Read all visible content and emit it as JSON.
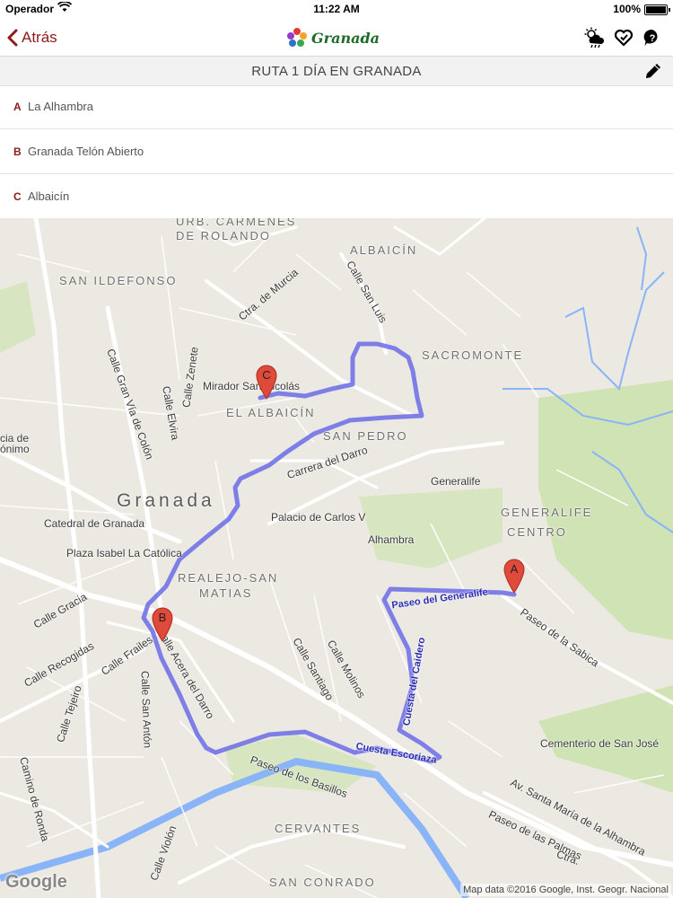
{
  "status": {
    "carrier": "Operador",
    "time": "11:22 AM",
    "battery": "100%"
  },
  "nav": {
    "back_label": "Atrás",
    "logo_text": "Granada"
  },
  "title": {
    "text": "RUTA 1 DÍA EN GRANADA"
  },
  "stops": [
    {
      "letter": "A",
      "name": "La Alhambra"
    },
    {
      "letter": "B",
      "name": "Granada Telón Abierto"
    },
    {
      "letter": "C",
      "name": "Albaicín"
    }
  ],
  "map": {
    "labels": {
      "urb_carmenes": "URB. CARMENES",
      "de_rolando": "DE ROLANDO",
      "albaicin_dist": "ALBAICÍN",
      "san_ildefonso": "SAN ILDEFONSO",
      "ctra_murcia": "Ctra. de Murcia",
      "calle_san_luis": "Calle San Luis",
      "sacromonte": "SACROMONTE",
      "mirador": "Mirador San Nicolás",
      "el_albaicin": "EL ALBAICÍN",
      "san_pedro": "SAN PEDRO",
      "carrera_darro": "Carrera del Darro",
      "generalife": "Generalife",
      "palacio": "Palacio de Carlos V",
      "generalife_centro_1": "GENERALIFE",
      "generalife_centro_2": "CENTRO",
      "alhambra": "Alhambra",
      "granada": "Granada",
      "catedral": "Catedral de Granada",
      "plaza_isabel": "Plaza Isabel La Católica",
      "realejo_1": "REALEJO-SAN",
      "realejo_2": "MATIAS",
      "calle_gran_via": "Calle Gran Vía de Colón",
      "calle_zenete": "Calle Zenete",
      "calle_elvira": "Calle Elvira",
      "calle_gracia": "Calle Gracia",
      "calle_recogidas": "Calle Recogidas",
      "calle_frailes": "Calle Frailes",
      "calle_tejeiro": "Calle Tejeiro",
      "calle_san_anton": "Calle San Antón",
      "calle_acera_darro": "Calle Acera del Darro",
      "calle_santiago": "Calle Santiago",
      "calle_molinos": "Calle Molinos",
      "paseo_generalife": "Paseo del Generalife",
      "cuesta_caidero": "Cuesta del Caidero",
      "cuesta_escoriaza": "Cuesta Escoriaza",
      "paseo_sabica": "Paseo de la Sabica",
      "cementerio": "Cementerio de San José",
      "av_santa_maria": "Av. Santa María de la Alhambra",
      "paseo_palmas": "Paseo de las Palmas",
      "paseo_basillos": "Paseo de los Basillos",
      "cervantes": "CERVANTES",
      "san_conrado": "SAN CONRADO",
      "camino_ronda": "Camino de Ronda",
      "calle_violon": "Calle Violón",
      "onimo": "ónimo",
      "cia_de": "cia de",
      "cra": "Ctra."
    },
    "markers": {
      "a": "A",
      "b": "B",
      "c": "C"
    },
    "google": "Google",
    "attribution": "Map data ©2016 Google, Inst. Geogr. Nacional"
  },
  "colors": {
    "accent": "#8b1a1a",
    "route": "#6b6be8",
    "park": "#cfe3b4",
    "water": "#8ab4f8"
  }
}
